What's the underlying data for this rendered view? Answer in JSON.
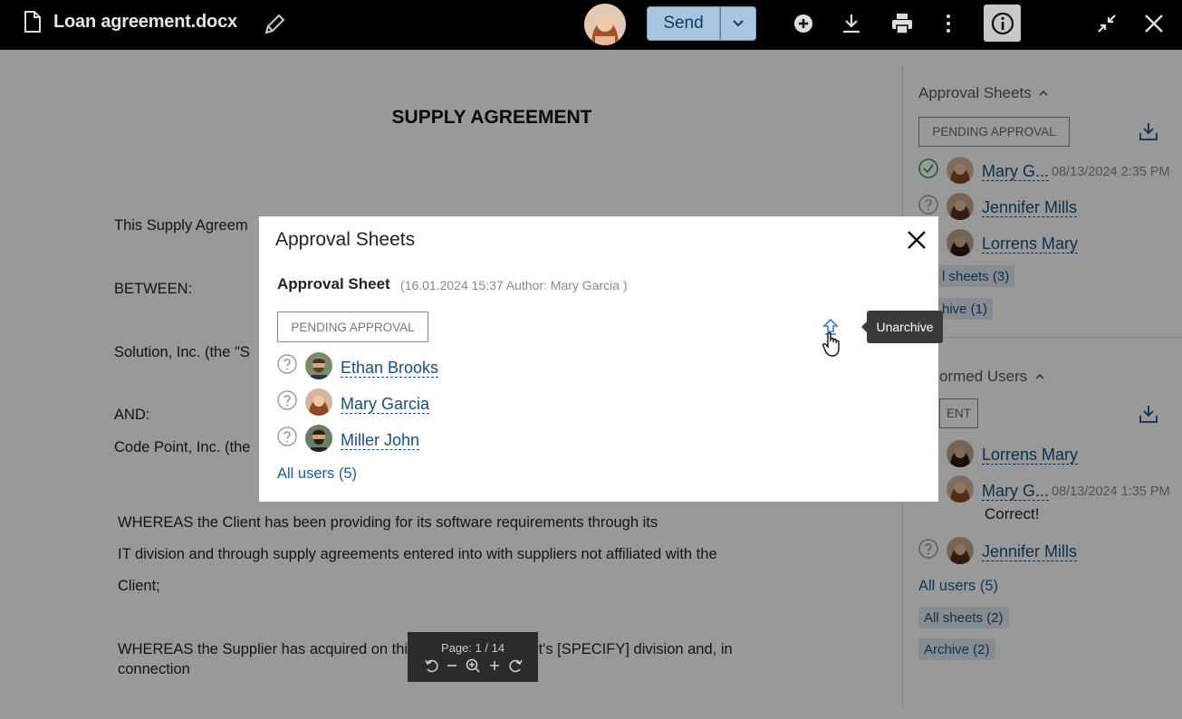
{
  "header": {
    "file_title": "Loan agreement.docx",
    "send_label": "Send",
    "icons": [
      "file-icon",
      "pencil-icon",
      "add-icon",
      "download-icon",
      "print-icon",
      "more-icon",
      "info-icon",
      "minimize-icon",
      "close-icon"
    ]
  },
  "document": {
    "title": "SUPPLY AGREEMENT",
    "lines": [
      "This Supply Agreem",
      "BETWEEN:",
      "Solution, Inc. (the \"S",
      "AND:",
      "Code Point, Inc. (the",
      "WHEREAS the Client has been providing for its software requirements through its",
      "IT division and through supply agreements entered into with suppliers not affiliated with the",
      "Client;",
      "WHEREAS the Supplier has acquired on this",
      "Client's [SPECIFY] division and, in",
      "connection"
    ]
  },
  "pager": {
    "label": "Page: 1 / 14"
  },
  "modal": {
    "title": "Approval Sheets",
    "sheet_title": "Approval Sheet",
    "sheet_meta": "(16.01.2024 15:37 Author: Mary Garcia )",
    "status": "PENDING APPROVAL",
    "users": [
      "Ethan Brooks",
      "Mary Garcia",
      "Miller John"
    ],
    "all_users": "All users (5)",
    "tooltip": "Unarchive"
  },
  "right_panel": {
    "approval_heading": "Approval Sheets",
    "approval_status": "PENDING APPROVAL",
    "approvers": [
      {
        "name": "Mary G...",
        "date": "08/13/2024 2:35 PM",
        "state": "approved"
      },
      {
        "name": "Jennifer Mills",
        "state": "pending"
      },
      {
        "name": "Lorrens Mary",
        "state": "none"
      }
    ],
    "sheets_chip": "l sheets (3)",
    "archive_chip": "hive (1)",
    "informed_heading": "ormed Users",
    "informed_status": "ENT",
    "informed": [
      {
        "name": "Lorrens Mary"
      },
      {
        "name": "Mary G...",
        "date": "08/13/2024 1:35 PM",
        "comment": "Correct!"
      },
      {
        "name": "Jennifer Mills"
      }
    ],
    "all_users": "All users (5)",
    "all_sheets": "All sheets (2)",
    "archive": "Archive (2)"
  },
  "colors": {
    "accent": "#1a4d7e",
    "send_bg": "#a9c6e0",
    "approved": "#3a9a4a"
  }
}
